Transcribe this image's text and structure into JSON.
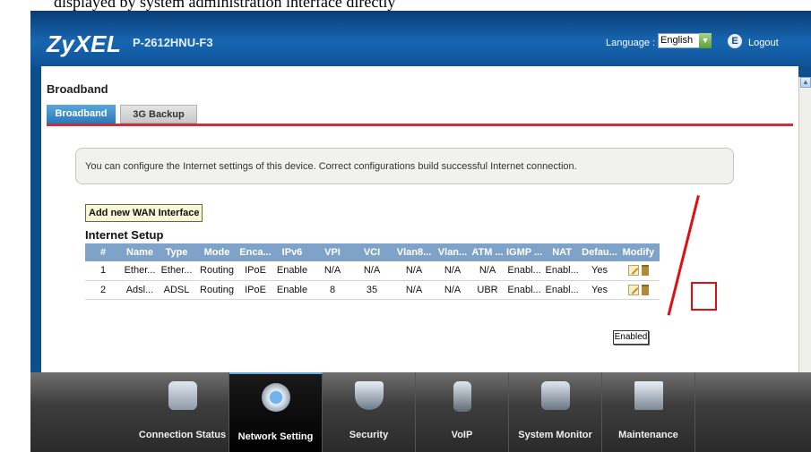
{
  "top_strip": "displayed by system administration interface directly",
  "header": {
    "brand": "ZyXEL",
    "model": "P-2612HNU-F3",
    "language_label": "Language :",
    "language_value": "English",
    "logout_label": "Logout"
  },
  "page": {
    "title": "Broadband",
    "tabs": [
      {
        "label": "Broadband",
        "active": true
      },
      {
        "label": "3G Backup",
        "active": false
      }
    ],
    "notice": "You can configure the Internet settings of this device. Correct configurations build successful Internet connection.",
    "add_button": "Add new WAN Interface",
    "section_title": "Internet Setup"
  },
  "table": {
    "headers": [
      "#",
      "Name",
      "Type",
      "Mode",
      "Enca...",
      "IPv6",
      "VPI",
      "VCI",
      "Vlan8...",
      "Vlan...",
      "ATM ...",
      "IGMP ...",
      "NAT",
      "Defau...",
      "Modify"
    ],
    "rows": [
      [
        "1",
        "Ether...",
        "Ether...",
        "Routing",
        "IPoE",
        "Enable",
        "N/A",
        "N/A",
        "N/A",
        "N/A",
        "N/A",
        "Enabl...",
        "Enabl...",
        "Yes"
      ],
      [
        "2",
        "Adsl...",
        "ADSL",
        "Routing",
        "IPoE",
        "Enable",
        "8",
        "35",
        "N/A",
        "N/A",
        "UBR",
        "Enabl...",
        "Enabl...",
        "Yes"
      ]
    ]
  },
  "tooltip": "Enabled",
  "nav": [
    {
      "label": "Connection Status",
      "icon": "connection-status-icon",
      "active": false
    },
    {
      "label": "Network Setting",
      "icon": "network-setting-icon",
      "active": true
    },
    {
      "label": "Security",
      "icon": "security-icon",
      "active": false
    },
    {
      "label": "VoIP",
      "icon": "voip-icon",
      "active": false
    },
    {
      "label": "System Monitor",
      "icon": "system-monitor-icon",
      "active": false
    },
    {
      "label": "Maintenance",
      "icon": "maintenance-icon",
      "active": false
    }
  ],
  "colors": {
    "header_blue": "#0d4f8e",
    "tab_active": "#2a78b8",
    "tab_underline": "#c0343a",
    "table_header": "#7fa3c8",
    "annotation_red": "#e01010"
  }
}
